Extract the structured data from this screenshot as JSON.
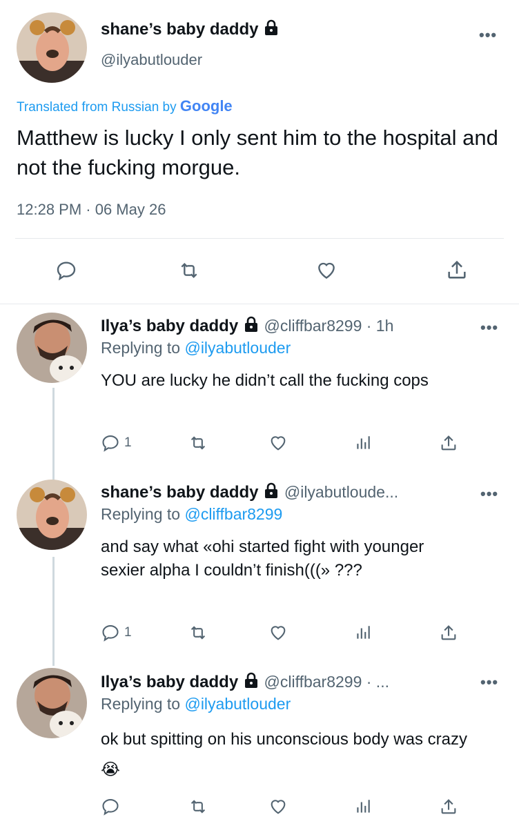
{
  "main_tweet": {
    "display_name": "shane’s baby daddy",
    "handle": "@ilyabutlouder",
    "translated_prefix": "Translated from Russian by",
    "translator_brand": "Google",
    "text": "Matthew is lucky I only sent him to the hospital and not the fucking morgue.",
    "timestamp": "12:28 PM · 06 May 26",
    "more": "•••"
  },
  "replies": [
    {
      "display_name": "Ilya’s baby daddy",
      "handle_meta": "@cliffbar8299 · 1h",
      "replying_prefix": "Replying to",
      "replying_to": "@ilyabutlouder",
      "text": "YOU are lucky he didn’t call the fucking cops",
      "reply_count": "1",
      "more": "•••"
    },
    {
      "display_name": "shane’s baby daddy",
      "handle_meta": "@ilyabutloude...",
      "replying_prefix": "Replying to",
      "replying_to": "@cliffbar8299",
      "text": "and say what «ohi started fight with younger sexier alpha I couldn’t finish(((» ???",
      "reply_count": "1",
      "more": "•••"
    },
    {
      "display_name": "Ilya’s baby daddy",
      "handle_meta": "@cliffbar8299 · ...",
      "replying_prefix": "Replying to",
      "replying_to": "@ilyabutlouder",
      "text": "ok but spitting on his unconscious body was crazy",
      "emoji": "😭",
      "reply_count": "",
      "more": "•••"
    }
  ],
  "colors": {
    "text": "#0f1419",
    "secondary": "#536471",
    "link": "#1d9bf0",
    "divider": "#e6e9ec"
  },
  "icons": [
    "reply-icon",
    "retweet-icon",
    "like-icon",
    "views-icon",
    "share-icon",
    "lock-icon",
    "more-icon"
  ]
}
